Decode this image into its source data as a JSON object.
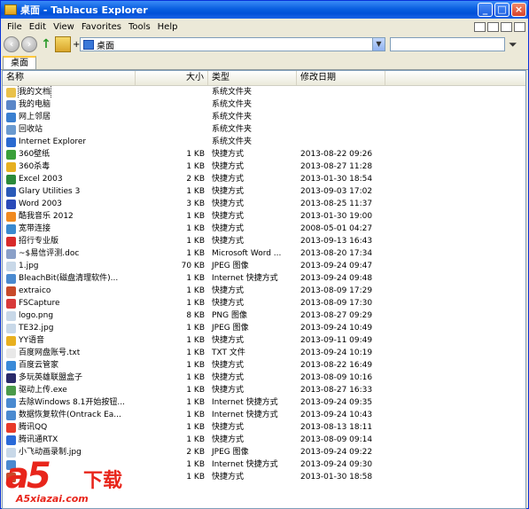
{
  "window": {
    "title": "桌面 - Tablacus Explorer"
  },
  "menu": [
    "File",
    "Edit",
    "View",
    "Favorites",
    "Tools",
    "Help"
  ],
  "address": {
    "value": "桌面"
  },
  "tabs": [
    "桌面"
  ],
  "columns": {
    "name": "名称",
    "size": "大小",
    "type": "类型",
    "date": "修改日期"
  },
  "files": [
    {
      "name": "我的文档",
      "size": "",
      "type": "系统文件夹",
      "date": "",
      "icon": "my-documents-icon",
      "color": "#e9c14a"
    },
    {
      "name": "我的电脑",
      "size": "",
      "type": "系统文件夹",
      "date": "",
      "icon": "my-computer-icon",
      "color": "#5a86c8"
    },
    {
      "name": "网上邻居",
      "size": "",
      "type": "系统文件夹",
      "date": "",
      "icon": "network-icon",
      "color": "#3a7fd0"
    },
    {
      "name": "回收站",
      "size": "",
      "type": "系统文件夹",
      "date": "",
      "icon": "recycle-bin-icon",
      "color": "#6a9ad0"
    },
    {
      "name": "Internet Explorer",
      "size": "",
      "type": "系统文件夹",
      "date": "",
      "icon": "ie-icon",
      "color": "#2a6ad0"
    },
    {
      "name": "360壁纸",
      "size": "1 KB",
      "type": "快捷方式",
      "date": "2013-08-22 09:26",
      "icon": "360-wallpaper-icon",
      "color": "#3aa03a"
    },
    {
      "name": "360杀毒",
      "size": "1 KB",
      "type": "快捷方式",
      "date": "2013-08-27 11:28",
      "icon": "360-antivirus-icon",
      "color": "#e6b020"
    },
    {
      "name": "Excel 2003",
      "size": "2 KB",
      "type": "快捷方式",
      "date": "2013-01-30 18:54",
      "icon": "excel-icon",
      "color": "#2a8a3a"
    },
    {
      "name": "Glary Utilities 3",
      "size": "1 KB",
      "type": "快捷方式",
      "date": "2013-09-03 17:02",
      "icon": "glary-icon",
      "color": "#2a5ab8"
    },
    {
      "name": "Word 2003",
      "size": "3 KB",
      "type": "快捷方式",
      "date": "2013-08-25 11:37",
      "icon": "word-icon",
      "color": "#2a4ab8"
    },
    {
      "name": "酷我音乐 2012",
      "size": "1 KB",
      "type": "快捷方式",
      "date": "2013-01-30 19:00",
      "icon": "kuwo-music-icon",
      "color": "#f08a20"
    },
    {
      "name": "宽带连接",
      "size": "1 KB",
      "type": "快捷方式",
      "date": "2008-05-01 04:27",
      "icon": "broadband-icon",
      "color": "#3a8ad0"
    },
    {
      "name": "招行专业版",
      "size": "1 KB",
      "type": "快捷方式",
      "date": "2013-09-13 16:43",
      "icon": "cmb-icon",
      "color": "#d82a2a"
    },
    {
      "name": "~$易信评测.doc",
      "size": "1 KB",
      "type": "Microsoft Word ...",
      "date": "2013-08-20 17:34",
      "icon": "doc-icon",
      "color": "#8aa0c8"
    },
    {
      "name": "1.jpg",
      "size": "70 KB",
      "type": "JPEG 图像",
      "date": "2013-09-24 09:47",
      "icon": "image-file-icon",
      "color": "#c8d8e8"
    },
    {
      "name": "BleachBit(磁盘清理软件)...",
      "size": "1 KB",
      "type": "Internet 快捷方式",
      "date": "2013-09-24 09:48",
      "icon": "url-icon",
      "color": "#4a8ad0"
    },
    {
      "name": "extraico",
      "size": "1 KB",
      "type": "快捷方式",
      "date": "2013-08-09 17:29",
      "icon": "shortcut-icon",
      "color": "#c84a2a"
    },
    {
      "name": "FSCapture",
      "size": "1 KB",
      "type": "快捷方式",
      "date": "2013-08-09 17:30",
      "icon": "fscapture-icon",
      "color": "#d83a3a"
    },
    {
      "name": "logo.png",
      "size": "8 KB",
      "type": "PNG 图像",
      "date": "2013-08-27 09:29",
      "icon": "image-file-icon",
      "color": "#c8d8e8"
    },
    {
      "name": "TE32.jpg",
      "size": "1 KB",
      "type": "JPEG 图像",
      "date": "2013-09-24 10:49",
      "icon": "image-file-icon",
      "color": "#c8d8e8"
    },
    {
      "name": "YY语音",
      "size": "1 KB",
      "type": "快捷方式",
      "date": "2013-09-11 09:49",
      "icon": "yy-icon",
      "color": "#e8b020"
    },
    {
      "name": "百度网盘账号.txt",
      "size": "1 KB",
      "type": "TXT 文件",
      "date": "2013-09-24 10:19",
      "icon": "text-file-icon",
      "color": "#e8e8e8"
    },
    {
      "name": "百度云管家",
      "size": "1 KB",
      "type": "快捷方式",
      "date": "2013-08-22 16:49",
      "icon": "baidu-cloud-icon",
      "color": "#3a8ad8"
    },
    {
      "name": "多玩英雄联盟盒子",
      "size": "1 KB",
      "type": "快捷方式",
      "date": "2013-08-09 10:16",
      "icon": "lol-box-icon",
      "color": "#2a2a6a"
    },
    {
      "name": "驱动上传.exe",
      "size": "1 KB",
      "type": "快捷方式",
      "date": "2013-08-27 16:33",
      "icon": "exe-icon",
      "color": "#4a9a4a"
    },
    {
      "name": "去除Windows 8.1开始按钮...",
      "size": "1 KB",
      "type": "Internet 快捷方式",
      "date": "2013-09-24 09:35",
      "icon": "url-icon",
      "color": "#4a8ad0"
    },
    {
      "name": "数据恢复软件(Ontrack Ea...",
      "size": "1 KB",
      "type": "Internet 快捷方式",
      "date": "2013-09-24 10:43",
      "icon": "url-icon",
      "color": "#4a8ad0"
    },
    {
      "name": "腾讯QQ",
      "size": "1 KB",
      "type": "快捷方式",
      "date": "2013-08-13 18:11",
      "icon": "qq-icon",
      "color": "#e83a2a"
    },
    {
      "name": "腾讯通RTX",
      "size": "1 KB",
      "type": "快捷方式",
      "date": "2013-08-09 09:14",
      "icon": "rtx-icon",
      "color": "#2a6ad8"
    },
    {
      "name": "小飞动画录制.jpg",
      "size": "2 KB",
      "type": "JPEG 图像",
      "date": "2013-09-24 09:22",
      "icon": "image-file-icon",
      "color": "#c8d8e8"
    },
    {
      "name": "",
      "size": "1 KB",
      "type": "Internet 快捷方式",
      "date": "2013-09-24 09:30",
      "icon": "url-icon",
      "color": "#4a8ad0"
    },
    {
      "name": "",
      "size": "1 KB",
      "type": "快捷方式",
      "date": "2013-01-30 18:58",
      "icon": "shortcut-icon",
      "color": "#c84a2a"
    }
  ],
  "watermark": {
    "brand": "a5",
    "text": "下载",
    "url": "A5xiazai.com"
  }
}
